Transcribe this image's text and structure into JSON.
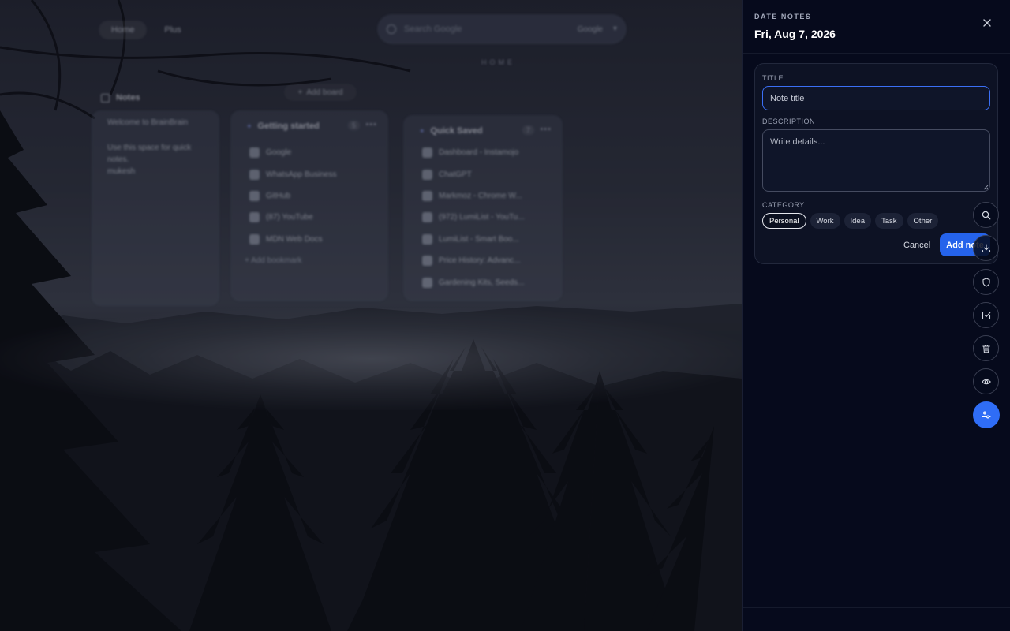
{
  "background": {
    "tabs": [
      "Home",
      "Plus"
    ],
    "search": {
      "placeholder": "Search Google",
      "engine": "Google"
    },
    "home_label": "HOME",
    "notes_header": "Notes",
    "add_board": "Add board",
    "notes_board": {
      "welcome": "Welcome to BrainBrain",
      "body": "Use this space for quick notes.\nmukesh"
    },
    "bookmarks_board": {
      "title": "Getting started",
      "count": "5",
      "items": [
        "Google",
        "WhatsApp Business",
        "GitHub",
        "(87) YouTube",
        "MDN Web Docs"
      ],
      "add_label": "Add bookmark"
    },
    "quick_saved_board": {
      "title": "Quick Saved",
      "count": "7",
      "items": [
        "Dashboard - Instamojo",
        "ChatGPT",
        "Markmoz - Chrome W...",
        "(972) LumiList - YouTu...",
        "LumiList - Smart Boo...",
        "Price History: Advanc...",
        "Gardening Kits, Seeds..."
      ]
    }
  },
  "panel": {
    "eyebrow": "DATE NOTES",
    "date": "Fri, Aug 7, 2026",
    "form": {
      "title_label": "TITLE",
      "title_placeholder": "Note title",
      "description_label": "DESCRIPTION",
      "description_placeholder": "Write details...",
      "category_label": "CATEGORY",
      "categories": [
        "Personal",
        "Work",
        "Idea",
        "Task",
        "Other"
      ],
      "selected_category": "Personal",
      "cancel_label": "Cancel",
      "submit_label": "Add note"
    }
  },
  "rail_icons": [
    "search-icon",
    "download-icon",
    "shield-icon",
    "checkbox-icon",
    "trash-icon",
    "eye-icon",
    "sliders-icon"
  ],
  "colors": {
    "accent": "#2563eb",
    "panel_bg": "#060a1c",
    "card_bg": "#0d1224",
    "focus_border": "#3b6ff5"
  }
}
